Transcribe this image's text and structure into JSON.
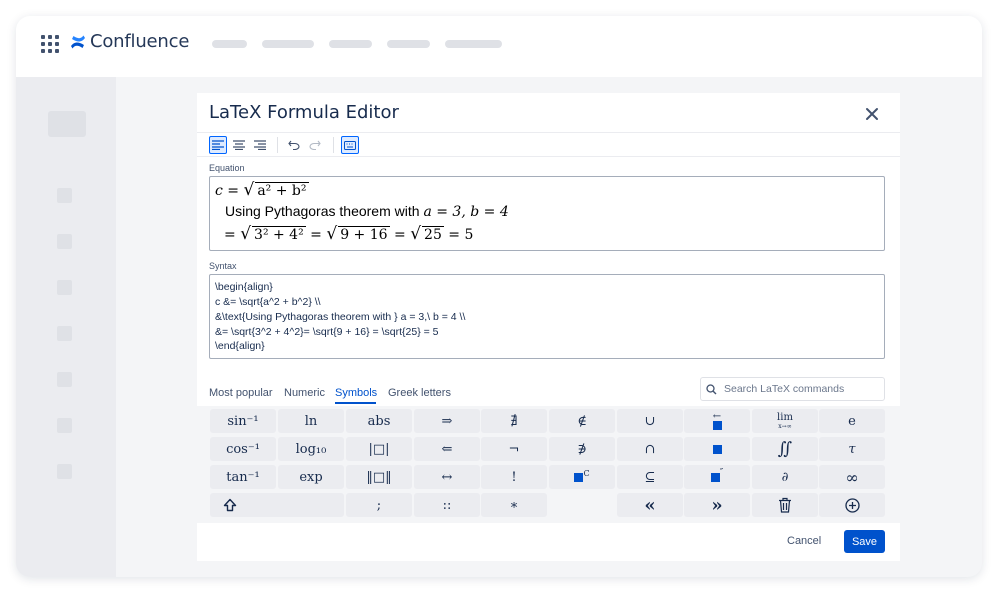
{
  "app": {
    "name": "Confluence"
  },
  "dialog": {
    "title": "LaTeX Formula Editor",
    "toolbar_icons": [
      "align-left-icon",
      "align-center-icon",
      "align-right-icon",
      "undo-icon",
      "redo-icon",
      "keyboard-icon"
    ]
  },
  "equation": {
    "label": "Equation",
    "line1": {
      "lhs": "c = ",
      "rad": "a² + b²"
    },
    "line2": {
      "text": "Using Pythagoras theorem with ",
      "math": "a = 3,  b = 4"
    },
    "line3": {
      "eq1": "= ",
      "rad1": "3² + 4²",
      "eq2": " = ",
      "rad2": "9 + 16",
      "eq3": " = ",
      "rad3": "25",
      "tail": " = 5"
    }
  },
  "syntax": {
    "label": "Syntax",
    "lines": [
      "\\begin{align}",
      "c &= \\sqrt{a^2 + b^2} \\\\",
      "&\\text{Using Pythagoras theorem with } a = 3,\\ b = 4 \\\\",
      "&= \\sqrt{3^2 + 4^2}= \\sqrt{9 + 16} = \\sqrt{25} = 5",
      "\\end{align}"
    ]
  },
  "tabs": [
    "Most popular",
    "Numeric",
    "Symbols",
    "Greek letters"
  ],
  "active_tab": "Symbols",
  "search": {
    "placeholder": "Search LaTeX commands"
  },
  "keys": {
    "row1": [
      "sin⁻¹",
      "ln",
      "abs",
      "⇒",
      "∄",
      "∉",
      "∪",
      "overleftarrow",
      "lim",
      "e"
    ],
    "row2": [
      "cos⁻¹",
      "log₁₀",
      "|□|",
      "⇐",
      "¬",
      "∌",
      "∩",
      "□",
      "∬",
      "τ"
    ],
    "row3": [
      "tan⁻¹",
      "exp",
      "‖□‖",
      "↔",
      "!",
      "□ᶜ",
      "⊆",
      "□″",
      "∂",
      "∞"
    ],
    "row4": [
      "shift-icon",
      ";",
      "::",
      "∗",
      "«",
      "»",
      "trash-icon",
      "add-icon"
    ],
    "lim_sub": "x→∞"
  },
  "footer": {
    "cancel": "Cancel",
    "save": "Save"
  },
  "colors": {
    "accent": "#0052cc",
    "key_bg": "#ebecf0"
  }
}
